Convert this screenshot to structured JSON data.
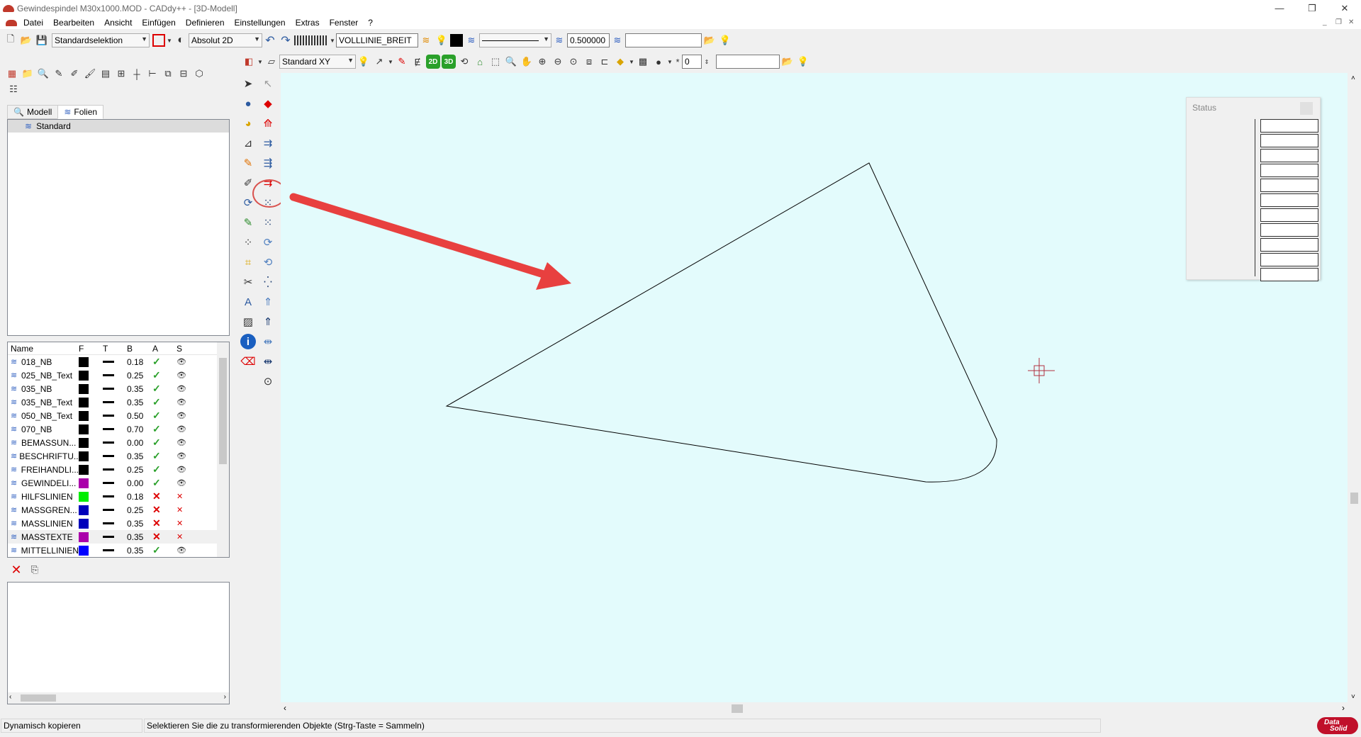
{
  "window": {
    "title": "Gewindespindel M30x1000.MOD  -  CADdy++ - [3D-Modell]",
    "minimize": "—",
    "restore": "❐",
    "close": "✕"
  },
  "menu": {
    "items": [
      "Datei",
      "Bearbeiten",
      "Ansicht",
      "Einfügen",
      "Definieren",
      "Einstellungen",
      "Extras",
      "Fenster",
      "?"
    ]
  },
  "toolbar1": {
    "selection": "Standardselektion",
    "coord_mode": "Absolut 2D",
    "linetype": "VOLLLINIE_BREIT",
    "line_width": "0.500000",
    "layer_field": ""
  },
  "toolbar2": {
    "view": "Standard XY",
    "btn_2d": "2D",
    "btn_3d": "3D",
    "level": "0",
    "field": ""
  },
  "tabs": {
    "model": "Modell",
    "layers": "Folien"
  },
  "layer_tree": {
    "root": "Standard"
  },
  "layer_table": {
    "headers": {
      "name": "Name",
      "f": "F",
      "t": "T",
      "b": "B",
      "a": "A",
      "s": "S"
    },
    "rows": [
      {
        "name": "018_NB",
        "color": "#000000",
        "b": "0.18",
        "active": "✓",
        "visible": "👁"
      },
      {
        "name": "025_NB_Text",
        "color": "#000000",
        "b": "0.25",
        "active": "✓",
        "visible": "👁"
      },
      {
        "name": "035_NB",
        "color": "#000000",
        "b": "0.35",
        "active": "✓",
        "visible": "👁"
      },
      {
        "name": "035_NB_Text",
        "color": "#000000",
        "b": "0.35",
        "active": "✓",
        "visible": "👁"
      },
      {
        "name": "050_NB_Text",
        "color": "#000000",
        "b": "0.50",
        "active": "✓",
        "visible": "👁"
      },
      {
        "name": "070_NB",
        "color": "#000000",
        "b": "0.70",
        "active": "✓",
        "visible": "👁"
      },
      {
        "name": "BEMASSUN...",
        "color": "#000000",
        "b": "0.00",
        "active": "✓",
        "visible": "👁"
      },
      {
        "name": "BESCHRIFTU...",
        "color": "#000000",
        "b": "0.35",
        "active": "✓",
        "visible": "👁"
      },
      {
        "name": "FREIHANDLI...",
        "color": "#000000",
        "b": "0.25",
        "active": "✓",
        "visible": "👁"
      },
      {
        "name": "GEWINDELI...",
        "color": "#aa00aa",
        "b": "0.00",
        "active": "✓",
        "visible": "👁"
      },
      {
        "name": "HILFSLINIEN",
        "color": "#00ee00",
        "b": "0.18",
        "active": "✕",
        "visible": "✕"
      },
      {
        "name": "MASSGREN...",
        "color": "#0000bb",
        "b": "0.25",
        "active": "✕",
        "visible": "✕"
      },
      {
        "name": "MASSLINIEN",
        "color": "#0000bb",
        "b": "0.35",
        "active": "✕",
        "visible": "✕"
      },
      {
        "name": "MASSTEXTE",
        "color": "#aa00aa",
        "b": "0.35",
        "active": "✕",
        "visible": "✕"
      },
      {
        "name": "MITTELLINIEN",
        "color": "#0000ff",
        "b": "0.35",
        "active": "✓",
        "visible": "👁"
      }
    ]
  },
  "status_window": {
    "title": "Status"
  },
  "statusbar": {
    "mode": "Dynamisch kopieren",
    "hint": "Selektieren Sie die zu transformierenden Objekte (Strg-Taste = Sammeln)",
    "logo_line1": "Data",
    "logo_line2": "Solid"
  },
  "colors": {
    "canvas": "#e3fbfc",
    "arrow": "#e8403f",
    "highlight": "#d9534f"
  }
}
